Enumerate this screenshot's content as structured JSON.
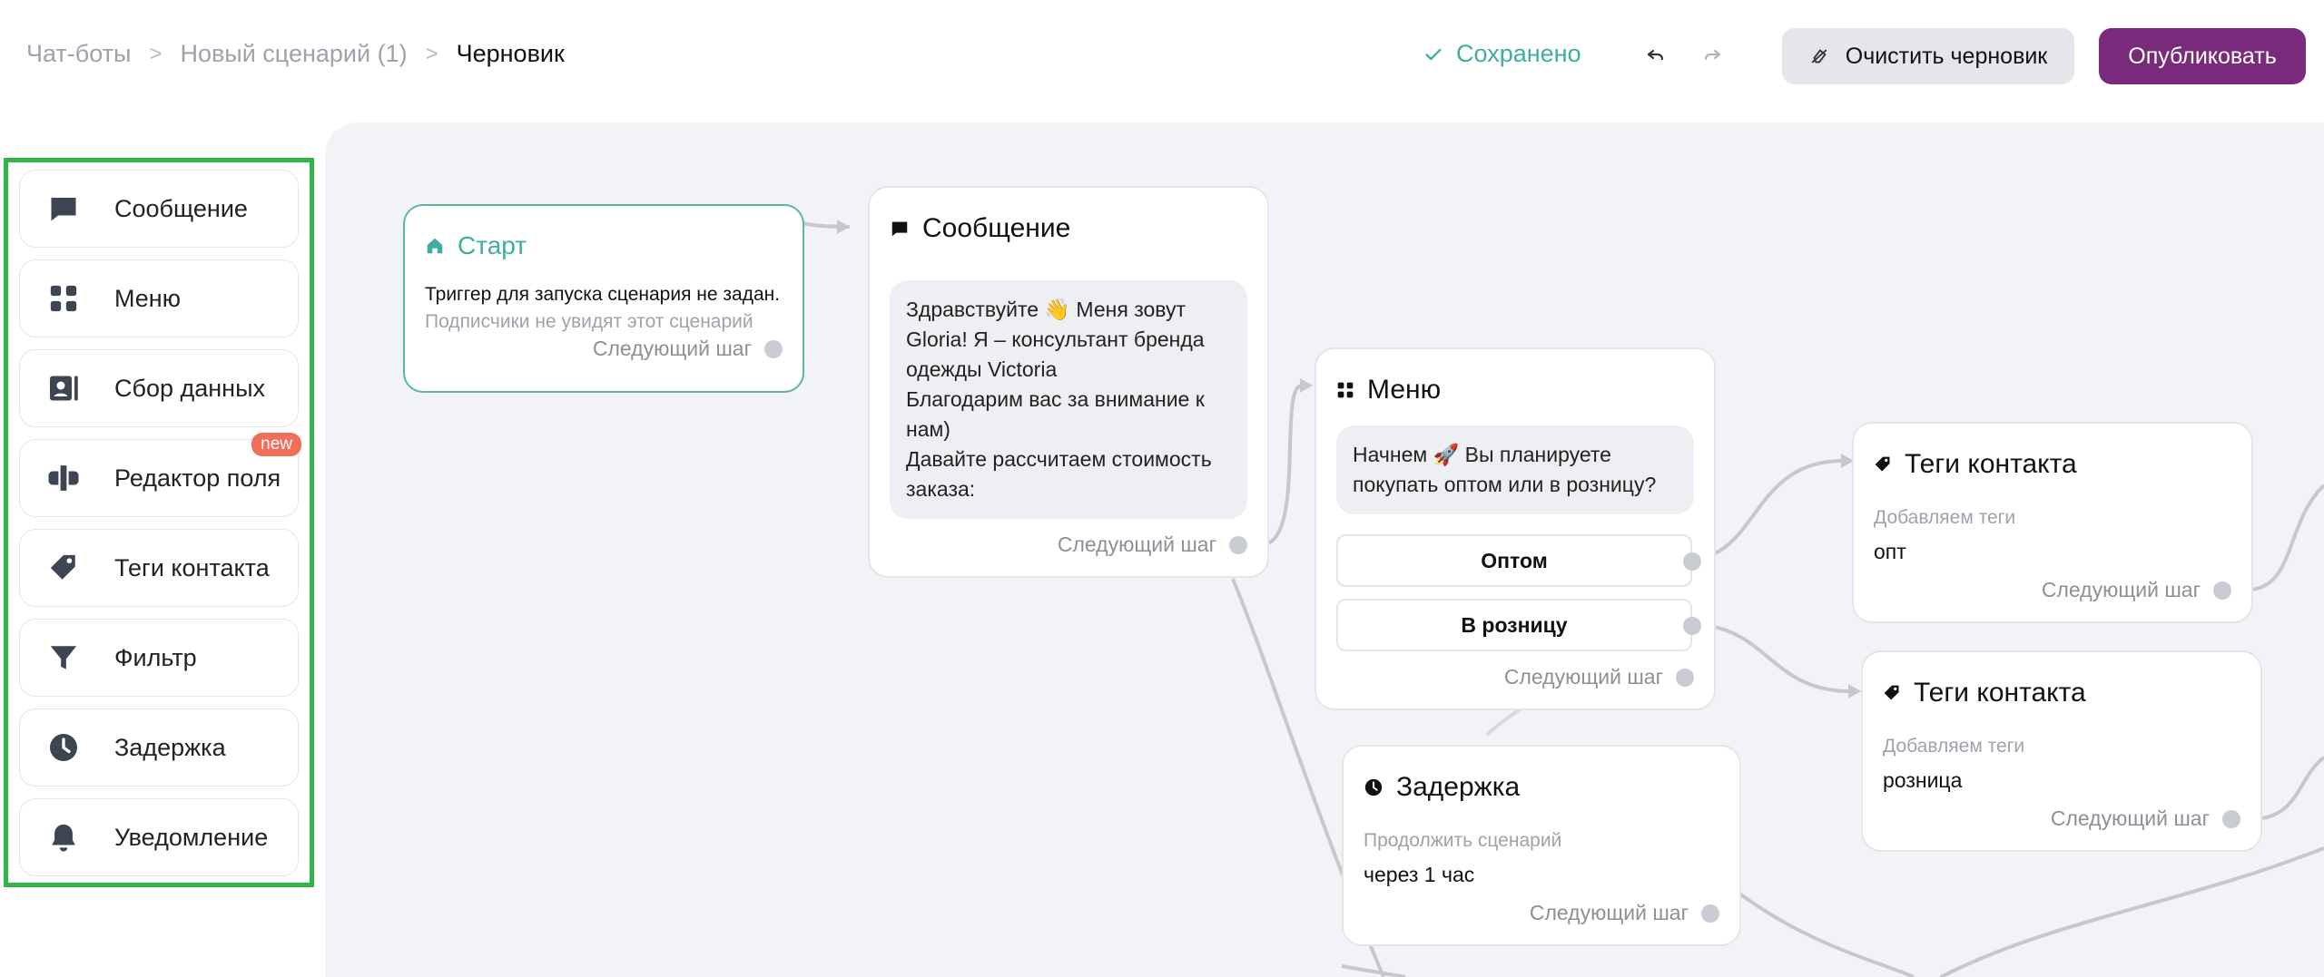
{
  "breadcrumb": {
    "item1": "Чат-боты",
    "item2": "Новый сценарий (1)",
    "item3": "Черновик",
    "sep": ">"
  },
  "header": {
    "saved": "Сохранено",
    "clear_label": "Очистить черновик",
    "publish_label": "Опубликовать"
  },
  "palette": {
    "items": [
      {
        "label": "Сообщение",
        "icon": "message-icon"
      },
      {
        "label": "Меню",
        "icon": "menu-grid-icon"
      },
      {
        "label": "Сбор данных",
        "icon": "contact-card-icon"
      },
      {
        "label": "Редактор поля",
        "icon": "field-editor-icon",
        "badge": "new"
      },
      {
        "label": "Теги контакта",
        "icon": "tag-icon"
      },
      {
        "label": "Фильтр",
        "icon": "filter-icon"
      },
      {
        "label": "Задержка",
        "icon": "clock-icon"
      },
      {
        "label": "Уведомление",
        "icon": "bell-icon"
      }
    ]
  },
  "nodes": {
    "start": {
      "title": "Старт",
      "line1": "Триггер для запуска сценария не задан.",
      "line2": "Подписчики не увидят этот сценарий",
      "next": "Следующий шаг"
    },
    "message": {
      "title": "Сообщение",
      "text_l1": "Здравствуйте 👋 Меня зовут",
      "text_l2": "Gloria! Я – консультант бренда",
      "text_l3": "одежды Victoria",
      "text_l4": "Благодарим вас за внимание к",
      "text_l5": "нам)",
      "text_l6": "Давайте рассчитаем стоимость",
      "text_l7": "заказа:",
      "next": "Следующий шаг"
    },
    "menu": {
      "title": "Меню",
      "text_l1": "Начнем 🚀 Вы планируете",
      "text_l2": "покупать оптом или в розницу?",
      "opt1": "Оптом",
      "opt2": "В розницу",
      "next": "Следующий шаг"
    },
    "tags1": {
      "title": "Теги контакта",
      "label": "Добавляем теги",
      "value": "опт",
      "next": "Следующий шаг"
    },
    "tags2": {
      "title": "Теги контакта",
      "label": "Добавляем теги",
      "value": "розница",
      "next": "Следующий шаг"
    },
    "delay": {
      "title": "Задержка",
      "label": "Продолжить сценарий",
      "value": "через 1 час",
      "next": "Следующий шаг"
    }
  },
  "colors": {
    "accent_purple": "#7a2a7a",
    "accent_teal": "#3fae9c",
    "palette_border": "#2fb64b",
    "new_badge": "#f26e5a"
  }
}
